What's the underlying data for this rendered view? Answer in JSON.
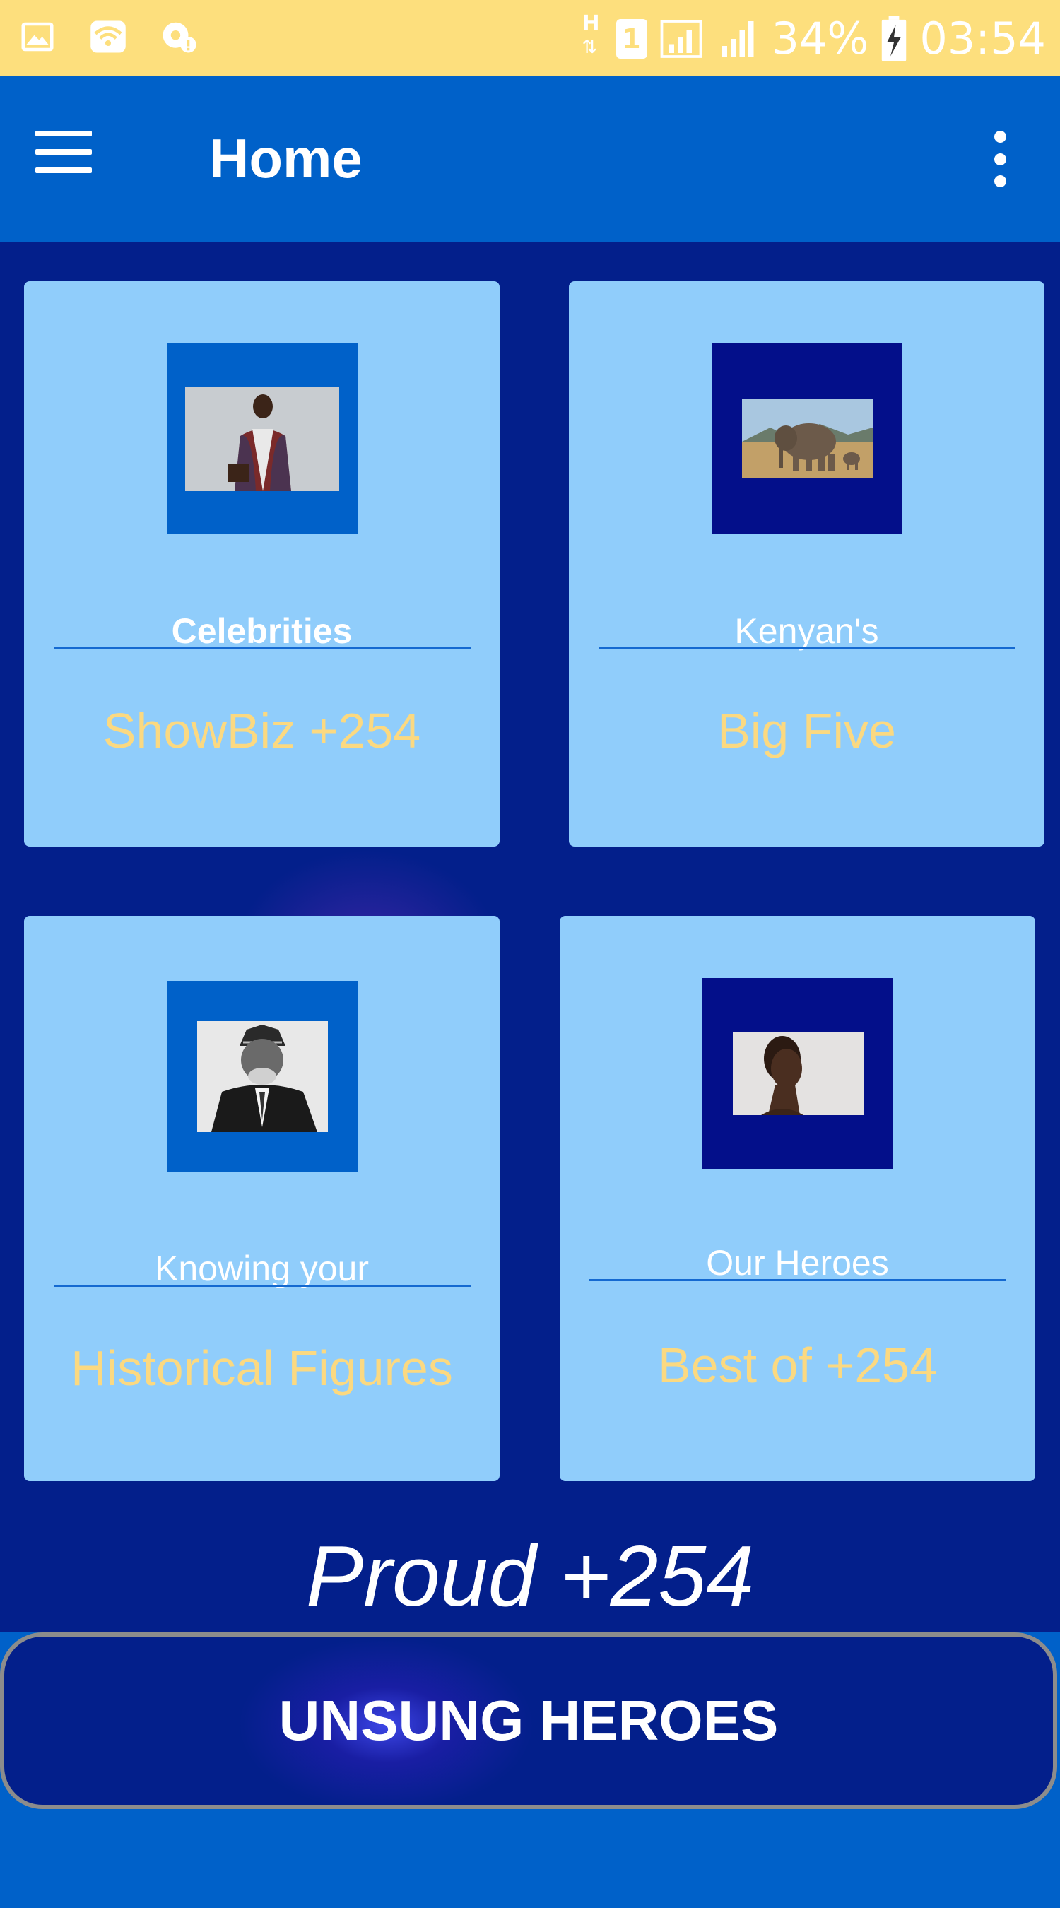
{
  "status_bar": {
    "battery_percent": "34%",
    "time": "03:54",
    "network_type": "H",
    "sim_slot": "1",
    "icons": [
      "image-icon",
      "wifi-icon",
      "data-saver-icon",
      "signal-icon",
      "battery-charging-icon"
    ]
  },
  "app_bar": {
    "title": "Home"
  },
  "cards": [
    {
      "subtitle": "Celebrities",
      "label": "ShowBiz +254",
      "frame_color": "#0061c9"
    },
    {
      "subtitle": "Kenyan's",
      "label": "Big Five",
      "frame_color": "#030f8a"
    },
    {
      "subtitle": "Knowing your",
      "label": "Historical Figures",
      "frame_color": "#0061c9"
    },
    {
      "subtitle": "Our Heroes",
      "label": "Best of +254",
      "frame_color": "#030f8a"
    }
  ],
  "footer_title": "Proud +254",
  "bottom_button": {
    "label": "UNSUNG HEROES"
  },
  "colors": {
    "status_bar": "#fddf7d",
    "app_bar": "#0061c9",
    "background": "#031f8b",
    "card": "#90cdfb",
    "card_label": "#fbd981"
  }
}
